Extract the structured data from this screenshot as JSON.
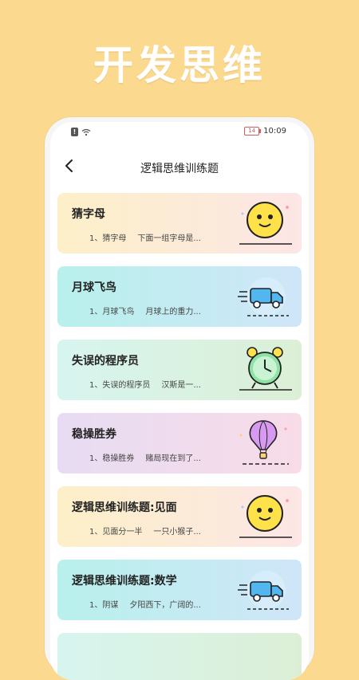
{
  "banner": {
    "title": "开发思维"
  },
  "status": {
    "time": "10:09",
    "battery": "14"
  },
  "nav": {
    "title": "逻辑思维训练题"
  },
  "cards": [
    {
      "title": "猜字母",
      "sub_a": "1、猜字母",
      "sub_b": "下面一组字母是...",
      "icon": "sun-face-icon"
    },
    {
      "title": "月球飞鸟",
      "sub_a": "1、月球飞鸟",
      "sub_b": "月球上的重力...",
      "icon": "delivery-truck-icon"
    },
    {
      "title": "失误的程序员",
      "sub_a": "1、失误的程序员",
      "sub_b": "汉斯是一...",
      "icon": "alarm-clock-icon"
    },
    {
      "title": "稳操胜券",
      "sub_a": "1、稳操胜券",
      "sub_b": "赌局现在到了...",
      "icon": "hot-air-balloon-icon"
    },
    {
      "title": "逻辑思维训练题:见面",
      "sub_a": "1、见面分一半",
      "sub_b": "一只小猴子...",
      "icon": "sun-face-icon"
    },
    {
      "title": "逻辑思维训练题:数学",
      "sub_a": "1、阴谋",
      "sub_b": "夕阳西下，广阔的...",
      "icon": "delivery-truck-icon"
    },
    {
      "title": "",
      "sub_a": "",
      "sub_b": "",
      "icon": ""
    }
  ]
}
